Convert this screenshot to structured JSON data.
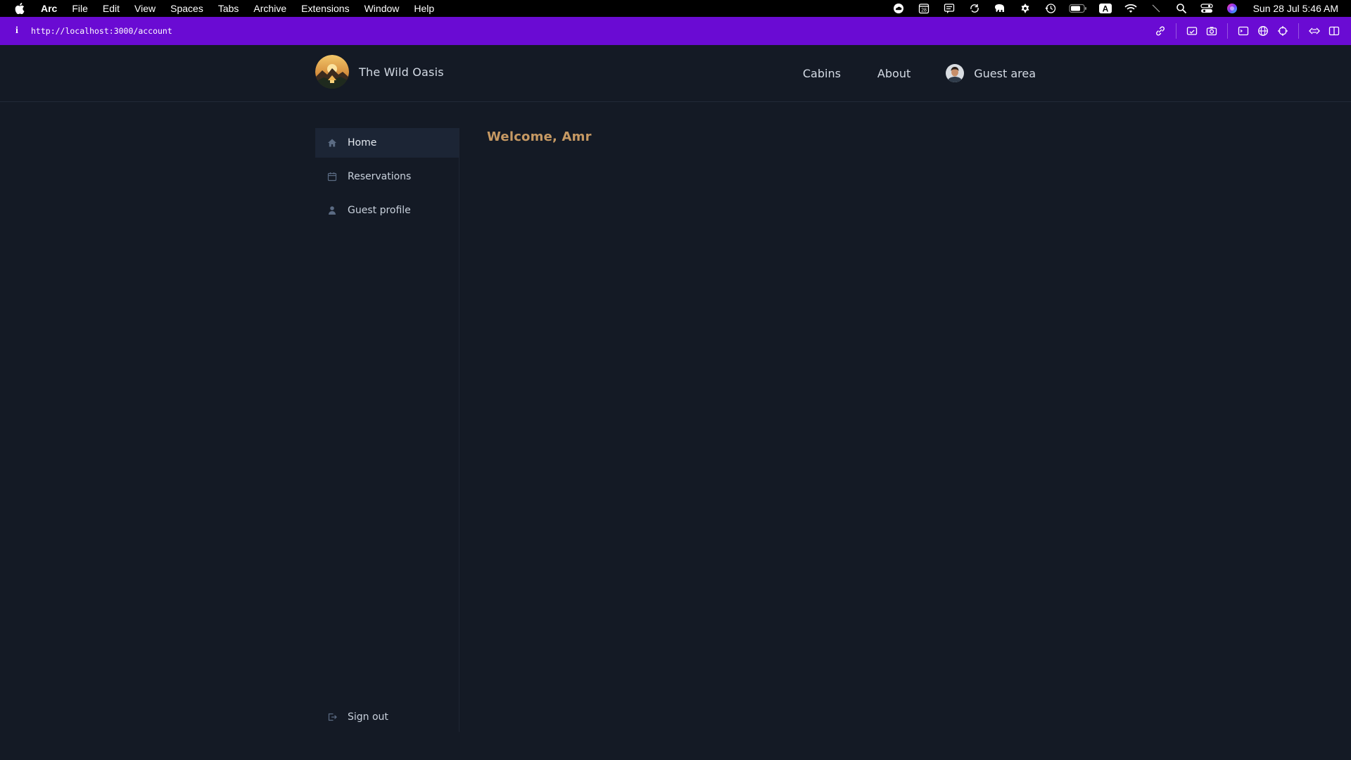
{
  "menubar": {
    "items": [
      "Arc",
      "File",
      "Edit",
      "View",
      "Spaces",
      "Tabs",
      "Archive",
      "Extensions",
      "Window",
      "Help"
    ],
    "tray_badge_calendar": "28",
    "tray_input_letter": "A",
    "clock": "Sun 28 Jul  5:46 AM"
  },
  "browser": {
    "url": "http://localhost:3000/account",
    "accent_color": "#6a0bd3"
  },
  "header": {
    "brand_name": "The Wild Oasis",
    "nav": {
      "cabins": "Cabins",
      "about": "About",
      "guest_area": "Guest area"
    }
  },
  "sidebar": {
    "items": [
      {
        "label": "Home",
        "icon": "home-icon",
        "active": true
      },
      {
        "label": "Reservations",
        "icon": "calendar-icon",
        "active": false
      },
      {
        "label": "Guest profile",
        "icon": "user-icon",
        "active": false
      }
    ],
    "sign_out": "Sign out"
  },
  "main": {
    "welcome": "Welcome, Amr",
    "accent_color": "#c69963"
  }
}
